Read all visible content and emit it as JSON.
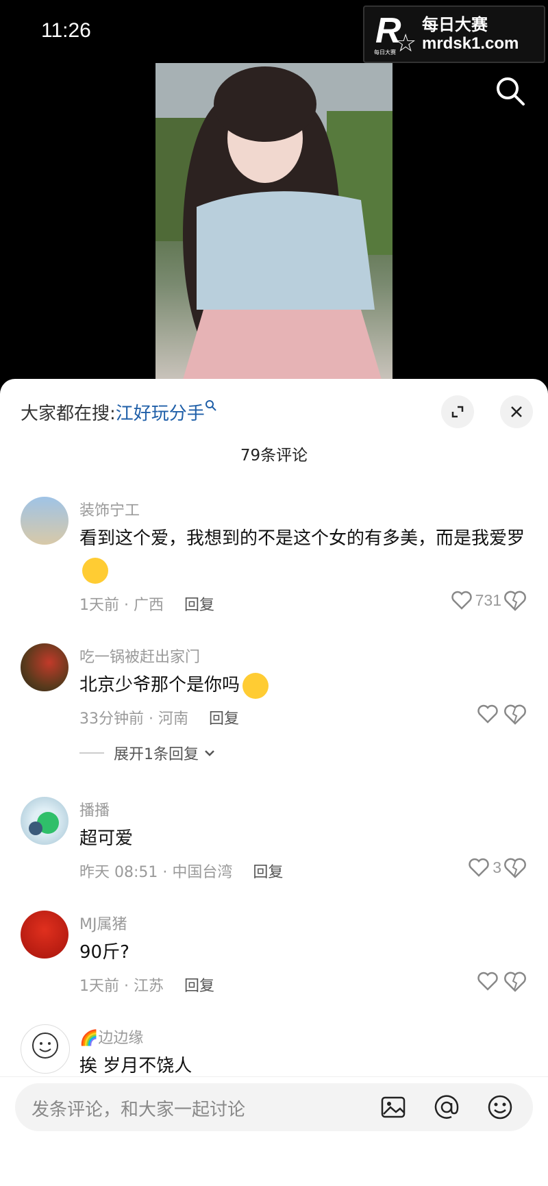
{
  "status": {
    "time": "11:26"
  },
  "watermark": {
    "cn": "每日大赛",
    "en": "mrdsk1.com",
    "badge": "每日大赛"
  },
  "trend": {
    "prefix": "大家都在搜:",
    "keyword": "江好玩分手"
  },
  "comments_count": "79条评论",
  "comments": [
    {
      "username": "装饰宁工",
      "text": "看到这个爱，我想到的不是这个女的有多美，而是我爱罗",
      "meta": "1天前 · 广西",
      "reply": "回复",
      "likes": "731"
    },
    {
      "username": "吃一锅被赶出家门",
      "text": "北京少爷那个是你吗",
      "meta": "33分钟前 · 河南",
      "reply": "回复",
      "likes": "",
      "expand": "展开1条回复"
    },
    {
      "username": "播播",
      "text": "超可爱",
      "meta": "昨天 08:51 · 中国台湾",
      "reply": "回复",
      "likes": "3"
    },
    {
      "username": "MJ属猪",
      "text": "90斤?",
      "meta": "1天前 · 江苏",
      "reply": "回复",
      "likes": ""
    },
    {
      "username": "🌈边边缘",
      "text": "挨 岁月不饶人"
    }
  ],
  "input": {
    "placeholder": "发条评论，和大家一起讨论"
  },
  "colors": {
    "accent": "#1f5fa8",
    "sheet": "#ffffff",
    "top": "#000000"
  }
}
